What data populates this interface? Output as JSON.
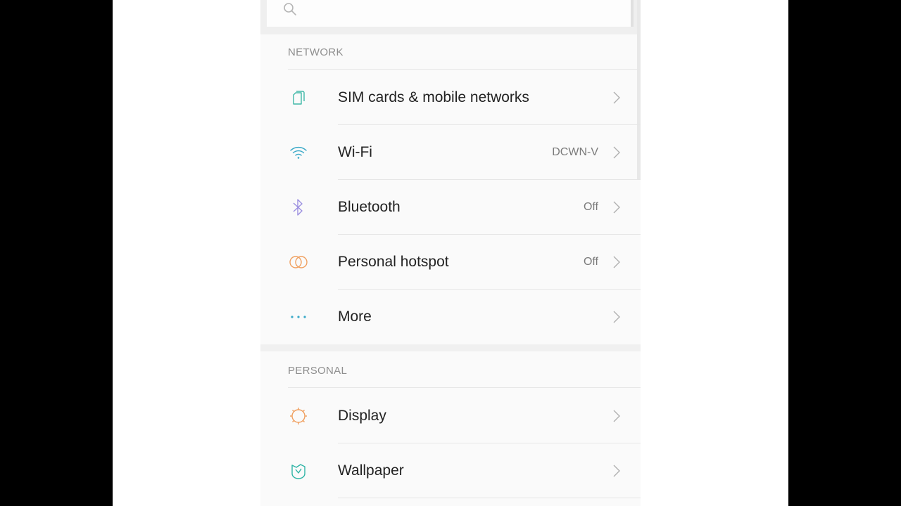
{
  "search": {
    "placeholder": ""
  },
  "sections": {
    "network": {
      "title": "NETWORK"
    },
    "personal": {
      "title": "PERSONAL"
    }
  },
  "items": {
    "sim": {
      "label": "SIM cards & mobile networks",
      "value": "",
      "icon": "sim-card-icon"
    },
    "wifi": {
      "label": "Wi-Fi",
      "value": "DCWN-V",
      "icon": "wifi-icon"
    },
    "bluetooth": {
      "label": "Bluetooth",
      "value": "Off",
      "icon": "bluetooth-icon"
    },
    "hotspot": {
      "label": "Personal hotspot",
      "value": "Off",
      "icon": "hotspot-icon"
    },
    "more": {
      "label": "More",
      "value": "",
      "icon": "more-dots-icon"
    },
    "display": {
      "label": "Display",
      "value": "",
      "icon": "display-icon"
    },
    "wallpaper": {
      "label": "Wallpaper",
      "value": "",
      "icon": "wallpaper-icon"
    }
  },
  "colors": {
    "background": "#fafafa",
    "label": "#222222",
    "secondary": "#7a7a7a",
    "sim": "#3fb8a8",
    "wifi": "#3aa9c8",
    "bluetooth": "#9b8fe0",
    "hotspot": "#f0a060",
    "more": "#3aa9c8",
    "display": "#f0a060",
    "wallpaper": "#2fb4a6"
  }
}
